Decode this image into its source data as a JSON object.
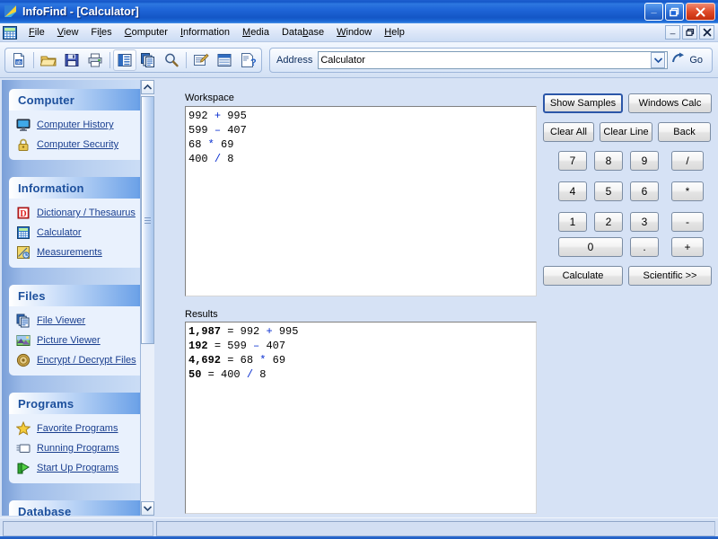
{
  "window": {
    "title": "InfoFind - [Calculator]",
    "app_icon": "infofind-logo-icon",
    "buttons": {
      "minimize": "_",
      "maximize": "❐",
      "close": "✕"
    }
  },
  "mdi_child_buttons": {
    "minimize": "_",
    "restore": "❐",
    "close": "✕"
  },
  "menubar": {
    "icon": "calculator-icon",
    "items": [
      {
        "label": "File",
        "accel": "F"
      },
      {
        "label": "View",
        "accel": "V"
      },
      {
        "label": "Files",
        "accel": "l"
      },
      {
        "label": "Computer",
        "accel": "C"
      },
      {
        "label": "Information",
        "accel": "I"
      },
      {
        "label": "Media",
        "accel": "M"
      },
      {
        "label": "Database",
        "accel": "b"
      },
      {
        "label": "Window",
        "accel": "W"
      },
      {
        "label": "Help",
        "accel": "H"
      }
    ]
  },
  "toolbar": {
    "buttons": [
      {
        "name": "new-document-icon"
      },
      {
        "name": "open-folder-icon"
      },
      {
        "name": "save-disk-icon"
      },
      {
        "name": "print-icon"
      },
      {
        "name": "list-view-icon"
      },
      {
        "name": "copy-icon"
      },
      {
        "name": "search-magnifier-icon"
      },
      {
        "name": "edit-notes-icon"
      },
      {
        "name": "details-view-icon"
      },
      {
        "name": "help-document-icon"
      }
    ],
    "address_label": "Address",
    "address_value": "Calculator",
    "address_placeholder": "Calculator",
    "go_label": "Go",
    "go_icon": "go-arrow-icon",
    "dropdown_icon": "chevron-down-icon"
  },
  "sidebar": {
    "scroll_up_icon": "chevron-up-icon",
    "scroll_down_icon": "chevron-down-icon",
    "groups": [
      {
        "title": "Computer",
        "items": [
          {
            "label": "Computer History",
            "icon": "monitor-icon"
          },
          {
            "label": "Computer Security",
            "icon": "padlock-icon"
          }
        ]
      },
      {
        "title": "Information",
        "items": [
          {
            "label": "Dictionary / Thesaurus",
            "icon": "dictionary-icon"
          },
          {
            "label": "Calculator",
            "icon": "calculator-icon"
          },
          {
            "label": "Measurements",
            "icon": "measurements-icon"
          }
        ]
      },
      {
        "title": "Files",
        "items": [
          {
            "label": "File Viewer",
            "icon": "file-viewer-icon"
          },
          {
            "label": "Picture Viewer",
            "icon": "picture-icon"
          },
          {
            "label": "Encrypt / Decrypt Files",
            "icon": "encryption-icon"
          }
        ]
      },
      {
        "title": "Programs",
        "items": [
          {
            "label": "Favorite Programs",
            "icon": "star-icon"
          },
          {
            "label": "Running Programs",
            "icon": "running-programs-icon"
          },
          {
            "label": "Start Up Programs",
            "icon": "startup-icon"
          }
        ]
      },
      {
        "title": "Database",
        "items": []
      }
    ]
  },
  "main": {
    "workspace_label": "Workspace",
    "workspace_lines": [
      {
        "left": "992",
        "op": "+",
        "right": "995"
      },
      {
        "left": "599",
        "op": "–",
        "right": "407"
      },
      {
        "left": "68",
        "op": "*",
        "right": "69"
      },
      {
        "left": "400",
        "op": "/",
        "right": "8"
      }
    ],
    "results_label": "Results",
    "results_lines": [
      {
        "answer": "1,987",
        "eq": "=",
        "left": "992",
        "op": "+",
        "right": "995"
      },
      {
        "answer": "192",
        "eq": "=",
        "left": "599",
        "op": "–",
        "right": "407"
      },
      {
        "answer": "4,692",
        "eq": "=",
        "left": "68",
        "op": "*",
        "right": "69"
      },
      {
        "answer": "50",
        "eq": "=",
        "left": "400",
        "op": "/",
        "right": "8"
      }
    ]
  },
  "calculator": {
    "show_samples": "Show Samples",
    "windows_calc": "Windows Calc",
    "clear_all": "Clear All",
    "clear_line": "Clear Line",
    "back": "Back",
    "keys": {
      "k7": "7",
      "k8": "8",
      "k9": "9",
      "div": "/",
      "k4": "4",
      "k5": "5",
      "k6": "6",
      "mul": "*",
      "k1": "1",
      "k2": "2",
      "k3": "3",
      "sub": "-",
      "k0": "0",
      "dot": ".",
      "add": "+"
    },
    "calculate": "Calculate",
    "scientific": "Scientific >>"
  },
  "statusbar": {
    "left": "",
    "right": ""
  },
  "colors": {
    "titlebar_blue": "#1f66d8",
    "accent_link": "#1a3f8f",
    "operator_blue": "#0a2fd0",
    "panel_bg": "#e9f1fd",
    "client_bg": "#d6e2f5"
  }
}
